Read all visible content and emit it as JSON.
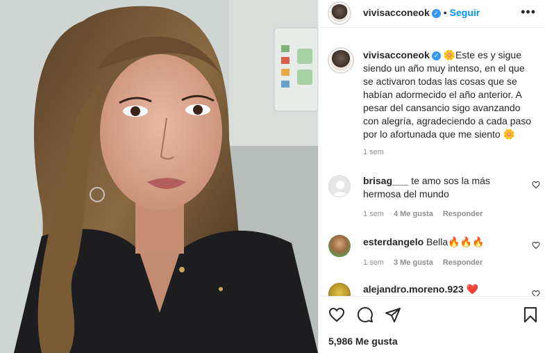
{
  "post": {
    "author": "vivisacconeok",
    "follow_label": "Seguir",
    "dot": "•",
    "more_label": "•••",
    "verified_glyph": "✓",
    "caption": "🌼Este es y sigue siendo un año muy intenso, en el que se activaron todas las cosas que se habían adormecido el año anterior. A pesar del cansancio sigo avanzando con alegría, agradeciendo a cada paso por lo afortunada que me siento 🌼",
    "caption_time": "1 sem",
    "likes": "5,986 Me gusta"
  },
  "comments": [
    {
      "user": "brisag___",
      "text": "te amo sos la más hermosa del mundo",
      "time": "1 sem",
      "likes": "4 Me gusta",
      "reply": "Responder"
    },
    {
      "user": "esterdangelo",
      "text": "Bella🔥🔥🔥",
      "time": "1 sem",
      "likes": "3 Me gusta",
      "reply": "Responder"
    },
    {
      "user": "alejandro.moreno.923",
      "text": "❤️"
    }
  ],
  "icons": {
    "like": "heart-icon",
    "comment": "comment-icon",
    "share": "paper-plane-icon",
    "save": "bookmark-icon",
    "more": "more-options-icon"
  },
  "colors": {
    "accent": "#0095f6",
    "verified": "#3897f0",
    "muted": "#8e8e8e",
    "text": "#262626"
  }
}
